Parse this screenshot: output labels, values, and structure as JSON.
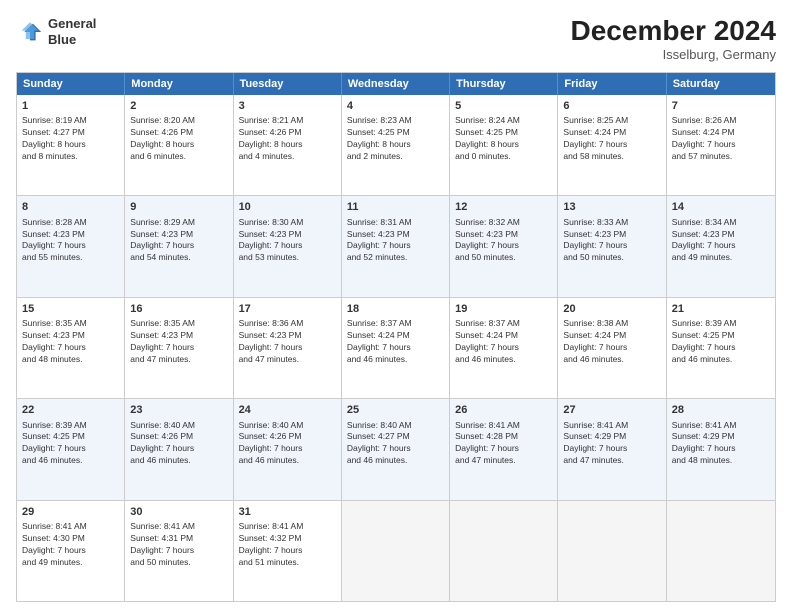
{
  "header": {
    "logo_line1": "General",
    "logo_line2": "Blue",
    "month": "December 2024",
    "location": "Isselburg, Germany"
  },
  "days": [
    "Sunday",
    "Monday",
    "Tuesday",
    "Wednesday",
    "Thursday",
    "Friday",
    "Saturday"
  ],
  "weeks": [
    [
      {
        "day": "1",
        "lines": [
          "Sunrise: 8:19 AM",
          "Sunset: 4:27 PM",
          "Daylight: 8 hours",
          "and 8 minutes."
        ]
      },
      {
        "day": "2",
        "lines": [
          "Sunrise: 8:20 AM",
          "Sunset: 4:26 PM",
          "Daylight: 8 hours",
          "and 6 minutes."
        ]
      },
      {
        "day": "3",
        "lines": [
          "Sunrise: 8:21 AM",
          "Sunset: 4:26 PM",
          "Daylight: 8 hours",
          "and 4 minutes."
        ]
      },
      {
        "day": "4",
        "lines": [
          "Sunrise: 8:23 AM",
          "Sunset: 4:25 PM",
          "Daylight: 8 hours",
          "and 2 minutes."
        ]
      },
      {
        "day": "5",
        "lines": [
          "Sunrise: 8:24 AM",
          "Sunset: 4:25 PM",
          "Daylight: 8 hours",
          "and 0 minutes."
        ]
      },
      {
        "day": "6",
        "lines": [
          "Sunrise: 8:25 AM",
          "Sunset: 4:24 PM",
          "Daylight: 7 hours",
          "and 58 minutes."
        ]
      },
      {
        "day": "7",
        "lines": [
          "Sunrise: 8:26 AM",
          "Sunset: 4:24 PM",
          "Daylight: 7 hours",
          "and 57 minutes."
        ]
      }
    ],
    [
      {
        "day": "8",
        "lines": [
          "Sunrise: 8:28 AM",
          "Sunset: 4:23 PM",
          "Daylight: 7 hours",
          "and 55 minutes."
        ]
      },
      {
        "day": "9",
        "lines": [
          "Sunrise: 8:29 AM",
          "Sunset: 4:23 PM",
          "Daylight: 7 hours",
          "and 54 minutes."
        ]
      },
      {
        "day": "10",
        "lines": [
          "Sunrise: 8:30 AM",
          "Sunset: 4:23 PM",
          "Daylight: 7 hours",
          "and 53 minutes."
        ]
      },
      {
        "day": "11",
        "lines": [
          "Sunrise: 8:31 AM",
          "Sunset: 4:23 PM",
          "Daylight: 7 hours",
          "and 52 minutes."
        ]
      },
      {
        "day": "12",
        "lines": [
          "Sunrise: 8:32 AM",
          "Sunset: 4:23 PM",
          "Daylight: 7 hours",
          "and 50 minutes."
        ]
      },
      {
        "day": "13",
        "lines": [
          "Sunrise: 8:33 AM",
          "Sunset: 4:23 PM",
          "Daylight: 7 hours",
          "and 50 minutes."
        ]
      },
      {
        "day": "14",
        "lines": [
          "Sunrise: 8:34 AM",
          "Sunset: 4:23 PM",
          "Daylight: 7 hours",
          "and 49 minutes."
        ]
      }
    ],
    [
      {
        "day": "15",
        "lines": [
          "Sunrise: 8:35 AM",
          "Sunset: 4:23 PM",
          "Daylight: 7 hours",
          "and 48 minutes."
        ]
      },
      {
        "day": "16",
        "lines": [
          "Sunrise: 8:35 AM",
          "Sunset: 4:23 PM",
          "Daylight: 7 hours",
          "and 47 minutes."
        ]
      },
      {
        "day": "17",
        "lines": [
          "Sunrise: 8:36 AM",
          "Sunset: 4:23 PM",
          "Daylight: 7 hours",
          "and 47 minutes."
        ]
      },
      {
        "day": "18",
        "lines": [
          "Sunrise: 8:37 AM",
          "Sunset: 4:24 PM",
          "Daylight: 7 hours",
          "and 46 minutes."
        ]
      },
      {
        "day": "19",
        "lines": [
          "Sunrise: 8:37 AM",
          "Sunset: 4:24 PM",
          "Daylight: 7 hours",
          "and 46 minutes."
        ]
      },
      {
        "day": "20",
        "lines": [
          "Sunrise: 8:38 AM",
          "Sunset: 4:24 PM",
          "Daylight: 7 hours",
          "and 46 minutes."
        ]
      },
      {
        "day": "21",
        "lines": [
          "Sunrise: 8:39 AM",
          "Sunset: 4:25 PM",
          "Daylight: 7 hours",
          "and 46 minutes."
        ]
      }
    ],
    [
      {
        "day": "22",
        "lines": [
          "Sunrise: 8:39 AM",
          "Sunset: 4:25 PM",
          "Daylight: 7 hours",
          "and 46 minutes."
        ]
      },
      {
        "day": "23",
        "lines": [
          "Sunrise: 8:40 AM",
          "Sunset: 4:26 PM",
          "Daylight: 7 hours",
          "and 46 minutes."
        ]
      },
      {
        "day": "24",
        "lines": [
          "Sunrise: 8:40 AM",
          "Sunset: 4:26 PM",
          "Daylight: 7 hours",
          "and 46 minutes."
        ]
      },
      {
        "day": "25",
        "lines": [
          "Sunrise: 8:40 AM",
          "Sunset: 4:27 PM",
          "Daylight: 7 hours",
          "and 46 minutes."
        ]
      },
      {
        "day": "26",
        "lines": [
          "Sunrise: 8:41 AM",
          "Sunset: 4:28 PM",
          "Daylight: 7 hours",
          "and 47 minutes."
        ]
      },
      {
        "day": "27",
        "lines": [
          "Sunrise: 8:41 AM",
          "Sunset: 4:29 PM",
          "Daylight: 7 hours",
          "and 47 minutes."
        ]
      },
      {
        "day": "28",
        "lines": [
          "Sunrise: 8:41 AM",
          "Sunset: 4:29 PM",
          "Daylight: 7 hours",
          "and 48 minutes."
        ]
      }
    ],
    [
      {
        "day": "29",
        "lines": [
          "Sunrise: 8:41 AM",
          "Sunset: 4:30 PM",
          "Daylight: 7 hours",
          "and 49 minutes."
        ]
      },
      {
        "day": "30",
        "lines": [
          "Sunrise: 8:41 AM",
          "Sunset: 4:31 PM",
          "Daylight: 7 hours",
          "and 50 minutes."
        ]
      },
      {
        "day": "31",
        "lines": [
          "Sunrise: 8:41 AM",
          "Sunset: 4:32 PM",
          "Daylight: 7 hours",
          "and 51 minutes."
        ]
      },
      {
        "day": "",
        "lines": []
      },
      {
        "day": "",
        "lines": []
      },
      {
        "day": "",
        "lines": []
      },
      {
        "day": "",
        "lines": []
      }
    ]
  ]
}
